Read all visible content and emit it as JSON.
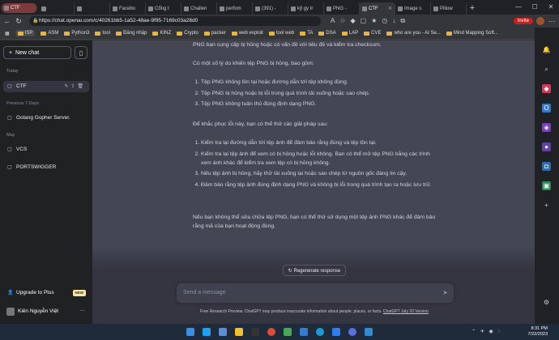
{
  "browser": {
    "tabs": [
      {
        "label": "CTF",
        "first": true
      },
      {
        "label": ""
      },
      {
        "label": ""
      },
      {
        "label": "Facebo"
      },
      {
        "label": "Cổng t"
      },
      {
        "label": "Challen"
      },
      {
        "label": "perfom"
      },
      {
        "label": "(391) -"
      },
      {
        "label": "kỹ gy tr"
      },
      {
        "label": "PNG -"
      },
      {
        "label": "CTF",
        "active": true
      },
      {
        "label": "Image s"
      },
      {
        "label": "Pillow"
      }
    ],
    "url": "https://chat.openai.com/c/40261bb5-1a52-48ae-9f95-7169c03a28d0",
    "invite_label": "Invite",
    "bookmarks": [
      "ISP",
      "ASM",
      "Python3",
      "tool",
      "Đăng nhập",
      "KINZ",
      "Crypto",
      "packer",
      "web exploit",
      "tool web",
      "TA",
      "DSA",
      "LAP",
      "CVE",
      "who are you - AI Se...",
      "Mind Mapping Soft..."
    ]
  },
  "sidebar": {
    "new_chat": "New chat",
    "sections": {
      "today": "Today",
      "prev7": "Previous 7 Days",
      "may": "May"
    },
    "items": {
      "ctf": "CTF",
      "golang": "Golang Gopher Server.",
      "vcs": "VCS",
      "portswigger": "PORTSWIGGER"
    },
    "upgrade": "Upgrade to Plus",
    "new_badge": "NEW",
    "user": "Kiên Nguyễn Việt"
  },
  "chat": {
    "intro": "PNG bạn cung cấp bị hỏng hoặc có vấn đề với tiêu đề và kiểm tra checksum.",
    "reasons_intro": "Có một số lý do khiến tệp PNG bị hỏng, bao gồm:",
    "reasons": [
      "Tệp PNG không tồn tại hoặc đường dẫn tới tệp không đúng.",
      "Tệp PNG bị hỏng hoặc bị lỗi trong quá trình tải xuống hoặc sao chép.",
      "Tệp PNG không tuân thủ đúng định dạng PNG."
    ],
    "fixes_intro": "Để khắc phục lỗi này, bạn có thể thử các giải pháp sau:",
    "fixes": [
      "Kiểm tra lại đường dẫn tới tệp ảnh để đảm bảo rằng đúng và tệp tồn tại.",
      "Kiểm tra lại tệp ảnh để xem có bị hỏng hoặc lỗi không. Bạn có thể mở tệp PNG bằng các trình xem ảnh khác để kiểm tra xem tệp có bị hỏng không.",
      "Nếu tệp ảnh bị hỏng, hãy thử tải xuống lại hoặc sao chép từ nguồn gốc đáng tin cậy.",
      "Đảm bảo rằng tệp ảnh đúng định dạng PNG và không bị lỗi trong quá trình tạo ra hoặc lưu trữ."
    ],
    "closing": "Nếu bạn không thể sửa chữa tệp PNG, bạn có thể thử sử dụng một tệp ảnh PNG khác để đảm bảo rằng mã của bạn hoạt động đúng.",
    "regenerate": "Regenerate response",
    "input_placeholder": "Send a message",
    "footer_text": "Free Research Preview. ChatGPT may produce inaccurate information about people, places, or facts. ",
    "footer_link": "ChatGPT July 20 Version"
  },
  "taskbar": {
    "time": "8:31 PM",
    "date": "7/22/2023"
  },
  "colors": {
    "sidebar": "#202123",
    "main": "#444654",
    "input": "#40414f",
    "invite": "#c5221f"
  }
}
